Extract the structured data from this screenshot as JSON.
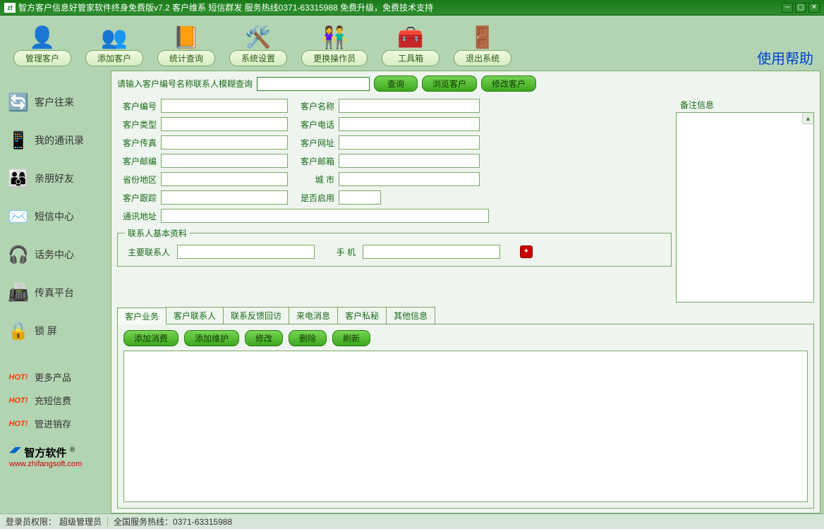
{
  "title_bar": {
    "logo": "zf",
    "text": "智方客户信息好管家软件终身免费版v7.2 客户维系 短信群发    服务热线0371-63315988 免费升级，免费技术支持"
  },
  "toolbar": [
    {
      "icon": "👤",
      "label": "管理客户"
    },
    {
      "icon": "👥",
      "label": "添加客户"
    },
    {
      "icon": "📙",
      "label": "统计查询"
    },
    {
      "icon": "🛠️",
      "label": "系统设置"
    },
    {
      "icon": "👫",
      "label": "更换操作员"
    },
    {
      "icon": "🧰",
      "label": "工具箱"
    },
    {
      "icon": "🚪",
      "label": "退出系统"
    }
  ],
  "help_link": "使用帮助",
  "sidebar": {
    "items": [
      {
        "icon": "🔄",
        "label": "客户往来"
      },
      {
        "icon": "📱",
        "label": "我的通讯录"
      },
      {
        "icon": "👨‍👩‍👦",
        "label": "亲朋好友"
      },
      {
        "icon": "✉️",
        "label": "短信中心"
      },
      {
        "icon": "🎧",
        "label": "话务中心"
      },
      {
        "icon": "📠",
        "label": "传真平台"
      },
      {
        "icon": "🔒",
        "label": "锁    屏"
      }
    ],
    "hot": [
      {
        "badge": "HOT!",
        "label": "更多产品"
      },
      {
        "badge": "HOT!",
        "label": "充短信费"
      },
      {
        "badge": "HOT!",
        "label": "管进销存"
      }
    ],
    "brand": {
      "name": "智方软件",
      "url": "www.zhifangsoft.com",
      "reg": "®"
    }
  },
  "search": {
    "label": "请输入客户编号名称联系人模糊查询",
    "btn_query": "查询",
    "btn_browse": "浏览客户",
    "btn_edit": "修改客户"
  },
  "form": {
    "labels": {
      "cust_no": "客户编号",
      "cust_name": "客户名称",
      "remark": "备注信息",
      "cust_type": "客户类型",
      "cust_phone": "客户电话",
      "cust_fax": "客户传真",
      "cust_url": "客户网址",
      "cust_zip": "客户邮编",
      "cust_email": "客户邮箱",
      "province": "省份地区",
      "city": "城    市",
      "follow": "客户跟踪",
      "enabled": "是否启用",
      "addr": "通讯地址"
    }
  },
  "contact": {
    "legend": "联系人基本资料",
    "main": "主要联系人",
    "phone": "手    机"
  },
  "tabs": [
    "客户业务",
    "客户联系人",
    "联系反馈回访",
    "来电消息",
    "客户私秘",
    "其他信息"
  ],
  "actions": {
    "add_spend": "添加消费",
    "add_maint": "添加维护",
    "edit": "修改",
    "delete": "删除",
    "refresh": "刷新"
  },
  "status": {
    "perm_label": "登录员权限：",
    "perm_value": "超级管理员",
    "hotline": "全国服务热线：0371-63315988"
  }
}
